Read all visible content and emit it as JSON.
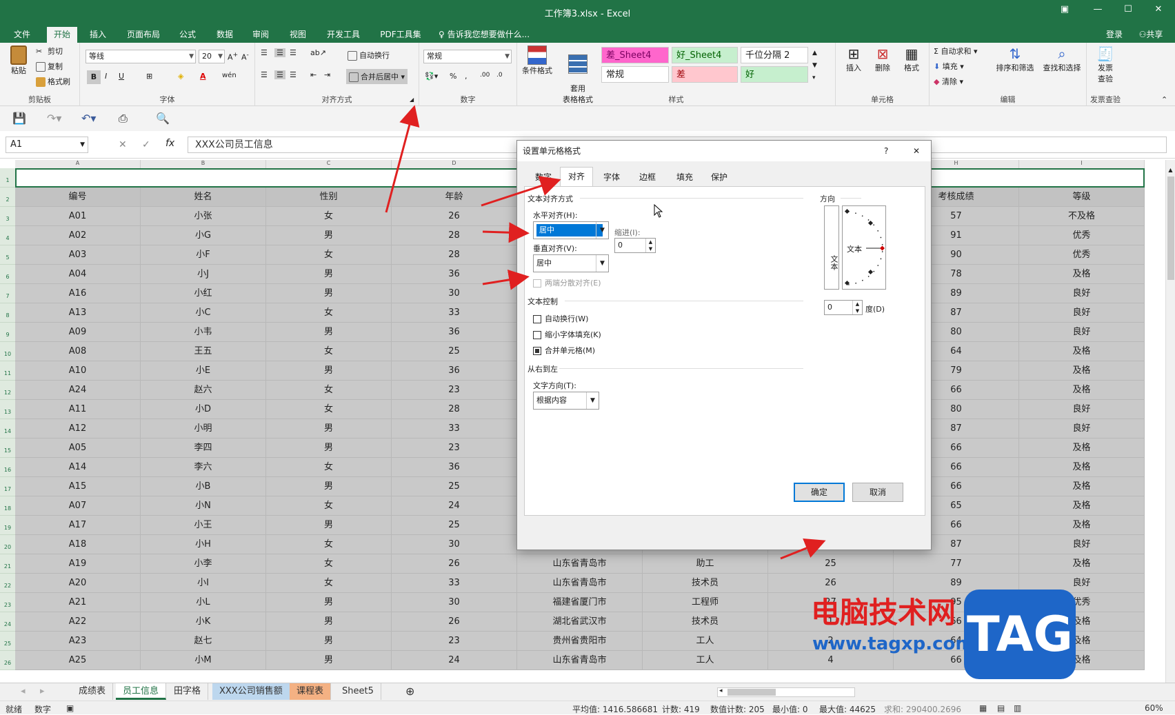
{
  "window": {
    "title": "工作簿3.xlsx - Excel",
    "login": "登录",
    "share": "共享"
  },
  "ribbon_tabs": [
    "文件",
    "开始",
    "插入",
    "页面布局",
    "公式",
    "数据",
    "审阅",
    "视图",
    "开发工具",
    "PDF工具集"
  ],
  "tell_me": "告诉我您想要做什么...",
  "clipboard": {
    "paste": "粘贴",
    "cut": "剪切",
    "copy": "复制",
    "format_painter": "格式刷",
    "label": "剪贴板"
  },
  "font": {
    "name": "等线",
    "size": "20",
    "bold": "B",
    "italic": "I",
    "underline": "U",
    "label": "字体"
  },
  "alignment": {
    "wrap": "自动换行",
    "merge": "合并后居中",
    "label": "对齐方式"
  },
  "number": {
    "format": "常规",
    "label": "数字"
  },
  "styles": {
    "cond_format": "条件格式",
    "table_format": "套用\n表格格式",
    "cells": [
      "差_Sheet4",
      "好_Sheet4",
      "千位分隔 2",
      "常规",
      "差",
      "好"
    ],
    "label": "样式"
  },
  "cells_group": {
    "insert": "插入",
    "delete": "删除",
    "format": "格式",
    "label": "单元格"
  },
  "editing": {
    "autosum": "自动求和",
    "fill": "填充",
    "clear": "清除",
    "sort": "排序和筛选",
    "find": "查找和选择",
    "label": "编辑"
  },
  "invoice": {
    "check": "发票\n查验",
    "label": "发票查验"
  },
  "namebox": "A1",
  "formula": "XXX公司员工信息",
  "columns": [
    "A",
    "B",
    "C",
    "D",
    "E",
    "F",
    "G",
    "H",
    "I"
  ],
  "headers": [
    "编号",
    "姓名",
    "性别",
    "年龄",
    "",
    "",
    "",
    "考核成绩",
    "等级"
  ],
  "rows": [
    [
      "A01",
      "小张",
      "女",
      "26",
      "",
      "",
      "",
      "57",
      "不及格"
    ],
    [
      "A02",
      "小G",
      "男",
      "28",
      "",
      "",
      "",
      "91",
      "优秀"
    ],
    [
      "A03",
      "小F",
      "女",
      "28",
      "",
      "",
      "",
      "90",
      "优秀"
    ],
    [
      "A04",
      "小J",
      "男",
      "36",
      "",
      "",
      "",
      "78",
      "及格"
    ],
    [
      "A16",
      "小红",
      "男",
      "30",
      "",
      "",
      "",
      "89",
      "良好"
    ],
    [
      "A13",
      "小C",
      "女",
      "33",
      "",
      "",
      "",
      "87",
      "良好"
    ],
    [
      "A09",
      "小韦",
      "男",
      "36",
      "",
      "",
      "",
      "80",
      "良好"
    ],
    [
      "A08",
      "王五",
      "女",
      "25",
      "",
      "",
      "",
      "64",
      "及格"
    ],
    [
      "A10",
      "小E",
      "男",
      "36",
      "",
      "",
      "",
      "79",
      "及格"
    ],
    [
      "A24",
      "赵六",
      "女",
      "23",
      "",
      "",
      "",
      "66",
      "及格"
    ],
    [
      "A11",
      "小D",
      "女",
      "28",
      "",
      "",
      "",
      "80",
      "良好"
    ],
    [
      "A12",
      "小明",
      "男",
      "33",
      "",
      "",
      "",
      "87",
      "良好"
    ],
    [
      "A05",
      "李四",
      "男",
      "23",
      "",
      "",
      "",
      "66",
      "及格"
    ],
    [
      "A14",
      "李六",
      "女",
      "36",
      "",
      "",
      "",
      "66",
      "及格"
    ],
    [
      "A15",
      "小B",
      "男",
      "25",
      "",
      "",
      "",
      "66",
      "及格"
    ],
    [
      "A07",
      "小N",
      "女",
      "24",
      "",
      "",
      "",
      "65",
      "及格"
    ],
    [
      "A17",
      "小王",
      "男",
      "25",
      "",
      "",
      "",
      "66",
      "及格"
    ],
    [
      "A18",
      "小H",
      "女",
      "30",
      "",
      "",
      "",
      "87",
      "良好"
    ],
    [
      "A19",
      "小李",
      "女",
      "26",
      "山东省青岛市",
      "助工",
      "25",
      "77",
      "及格"
    ],
    [
      "A20",
      "小I",
      "女",
      "33",
      "山东省青岛市",
      "技术员",
      "26",
      "89",
      "良好"
    ],
    [
      "A21",
      "小L",
      "男",
      "30",
      "福建省厦门市",
      "工程师",
      "27",
      "95",
      "优秀"
    ],
    [
      "A22",
      "小K",
      "男",
      "26",
      "湖北省武汉市",
      "技术员",
      "1",
      "66",
      "及格"
    ],
    [
      "A23",
      "赵七",
      "男",
      "23",
      "贵州省贵阳市",
      "工人",
      "2",
      "64",
      "及格"
    ],
    [
      "A25",
      "小M",
      "男",
      "24",
      "山东省青岛市",
      "工人",
      "4",
      "66",
      "及格"
    ]
  ],
  "row_numbers": [
    "1",
    "2",
    "3",
    "4",
    "5",
    "6",
    "7",
    "8",
    "9",
    "10",
    "11",
    "12",
    "13",
    "14",
    "15",
    "16",
    "17",
    "18",
    "19",
    "20",
    "21",
    "22",
    "23",
    "24",
    "25",
    "26"
  ],
  "sheet_tabs": [
    "成绩表",
    "员工信息",
    "田字格",
    "XXX公司销售额",
    "课程表",
    "Sheet5"
  ],
  "status": {
    "ready": "就绪",
    "mode": "数字",
    "average": "平均值: 1416.586681",
    "count": "计数: 419",
    "numcount": "数值计数: 205",
    "min": "最小值: 0",
    "max": "最大值: 44625",
    "sum": "求和: 290400.2696",
    "zoom": "60%"
  },
  "dialog": {
    "title": "设置单元格格式",
    "help": "?",
    "close": "✕",
    "tabs": [
      "数字",
      "对齐",
      "字体",
      "边框",
      "填充",
      "保护"
    ],
    "text_align_section": "文本对齐方式",
    "h_align_label": "水平对齐(H):",
    "h_align_value": "居中",
    "indent_label": "缩进(I):",
    "indent_value": "0",
    "v_align_label": "垂直对齐(V):",
    "v_align_value": "居中",
    "justify_distributed": "两端分散对齐(E)",
    "text_control_section": "文本控制",
    "wrap_text": "自动换行(W)",
    "shrink_to_fit": "缩小字体填充(K)",
    "merge_cells": "合并单元格(M)",
    "rtl_section": "从右到左",
    "text_direction_label": "文字方向(T):",
    "text_direction_value": "根据内容",
    "orientation_label": "方向",
    "orient_vertical_text": "文本",
    "orient_text": "文本",
    "degrees_value": "0",
    "degrees_label": "度(D)",
    "ok": "确定",
    "cancel": "取消"
  },
  "watermark": {
    "line1": "电脑技术网",
    "line2": "www.tagxp.com",
    "tag": "TAG"
  },
  "colors": {
    "excel_green": "#217346",
    "accent_blue": "#0078d7",
    "arrow_red": "#e02020"
  }
}
